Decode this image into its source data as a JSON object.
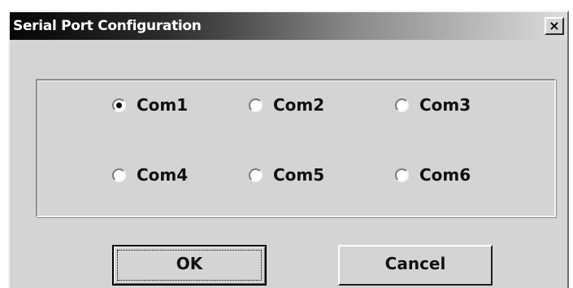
{
  "window": {
    "title": "Serial Port Configuration",
    "close_label": "×"
  },
  "ports": {
    "selected": "Com1",
    "options": [
      {
        "label": "Com1",
        "checked": true
      },
      {
        "label": "Com2",
        "checked": false
      },
      {
        "label": "Com3",
        "checked": false
      },
      {
        "label": "Com4",
        "checked": false
      },
      {
        "label": "Com5",
        "checked": false
      },
      {
        "label": "Com6",
        "checked": false
      }
    ]
  },
  "buttons": {
    "ok_label": "OK",
    "cancel_label": "Cancel"
  },
  "colors": {
    "dialog_face": "#d4d4d4",
    "title_text": "#ffffff"
  }
}
